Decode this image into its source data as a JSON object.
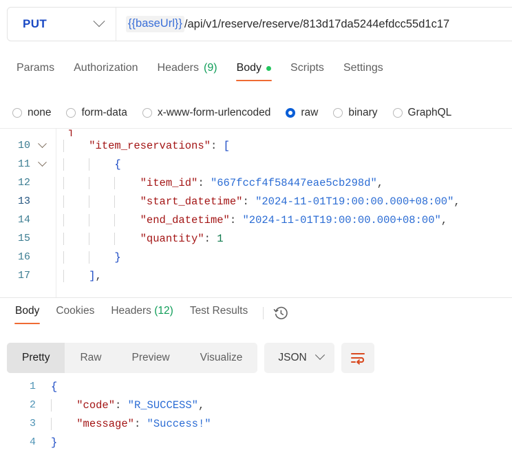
{
  "request": {
    "method": "PUT",
    "method_dropdown_icon": "chevron-down-icon",
    "url_variable": "{{baseUrl}}",
    "url_path": "/api/v1/reserve/reserve/813d17da5244efdcc55d1c17",
    "tabs": [
      {
        "label": "Params",
        "active": false,
        "count": "",
        "dot": false
      },
      {
        "label": "Authorization",
        "active": false,
        "count": "",
        "dot": false
      },
      {
        "label": "Headers",
        "active": false,
        "count": "(9)",
        "dot": false
      },
      {
        "label": "Body",
        "active": true,
        "count": "",
        "dot": true
      },
      {
        "label": "Scripts",
        "active": false,
        "count": "",
        "dot": false
      },
      {
        "label": "Settings",
        "active": false,
        "count": "",
        "dot": false
      }
    ],
    "body_types": [
      {
        "label": "none",
        "selected": false
      },
      {
        "label": "form-data",
        "selected": false
      },
      {
        "label": "x-www-form-urlencoded",
        "selected": false
      },
      {
        "label": "raw",
        "selected": true
      },
      {
        "label": "binary",
        "selected": false
      },
      {
        "label": "GraphQL",
        "selected": false
      }
    ],
    "clipped_line_above": "],",
    "code_lines": [
      {
        "number": "10",
        "foldable": true,
        "active": false,
        "indent_guides": 1,
        "tokens": [
          {
            "t": "    ",
            "c": "p"
          },
          {
            "t": "\"item_reservations\"",
            "c": "k"
          },
          {
            "t": ": ",
            "c": "p"
          },
          {
            "t": "[",
            "c": "b"
          }
        ]
      },
      {
        "number": "11",
        "foldable": true,
        "active": false,
        "indent_guides": 2,
        "tokens": [
          {
            "t": "        ",
            "c": "p"
          },
          {
            "t": "{",
            "c": "b"
          }
        ]
      },
      {
        "number": "12",
        "foldable": false,
        "active": false,
        "indent_guides": 3,
        "tokens": [
          {
            "t": "            ",
            "c": "p"
          },
          {
            "t": "\"item_id\"",
            "c": "k"
          },
          {
            "t": ": ",
            "c": "p"
          },
          {
            "t": "\"667fccf4f58447eae5cb298d\"",
            "c": "s"
          },
          {
            "t": ",",
            "c": "p"
          }
        ]
      },
      {
        "number": "13",
        "foldable": false,
        "active": true,
        "indent_guides": 3,
        "tokens": [
          {
            "t": "            ",
            "c": "p"
          },
          {
            "t": "\"start_datetime\"",
            "c": "k"
          },
          {
            "t": ": ",
            "c": "p"
          },
          {
            "t": "\"2024-11-01T19:00:00.000+08:00\"",
            "c": "s"
          },
          {
            "t": ",",
            "c": "p"
          }
        ]
      },
      {
        "number": "14",
        "foldable": false,
        "active": false,
        "indent_guides": 3,
        "tokens": [
          {
            "t": "            ",
            "c": "p"
          },
          {
            "t": "\"end_datetime\"",
            "c": "k"
          },
          {
            "t": ": ",
            "c": "p"
          },
          {
            "t": "\"2024-11-01T19:00:00.000+08:00\"",
            "c": "s"
          },
          {
            "t": ",",
            "c": "p"
          }
        ]
      },
      {
        "number": "15",
        "foldable": false,
        "active": false,
        "indent_guides": 3,
        "tokens": [
          {
            "t": "            ",
            "c": "p"
          },
          {
            "t": "\"quantity\"",
            "c": "k"
          },
          {
            "t": ": ",
            "c": "p"
          },
          {
            "t": "1",
            "c": "n"
          }
        ]
      },
      {
        "number": "16",
        "foldable": false,
        "active": false,
        "indent_guides": 2,
        "tokens": [
          {
            "t": "        ",
            "c": "p"
          },
          {
            "t": "}",
            "c": "b"
          }
        ]
      },
      {
        "number": "17",
        "foldable": false,
        "active": false,
        "indent_guides": 1,
        "tokens": [
          {
            "t": "    ",
            "c": "p"
          },
          {
            "t": "]",
            "c": "b"
          },
          {
            "t": ",",
            "c": "p"
          }
        ]
      }
    ]
  },
  "response": {
    "tabs": [
      {
        "label": "Body",
        "active": true,
        "count": ""
      },
      {
        "label": "Cookies",
        "active": false,
        "count": ""
      },
      {
        "label": "Headers",
        "active": false,
        "count": "(12)"
      },
      {
        "label": "Test Results",
        "active": false,
        "count": ""
      }
    ],
    "history_icon": "history-clock-icon",
    "format_tabs": [
      {
        "label": "Pretty",
        "active": true
      },
      {
        "label": "Raw",
        "active": false
      },
      {
        "label": "Preview",
        "active": false
      },
      {
        "label": "Visualize",
        "active": false
      }
    ],
    "language_select": {
      "value": "JSON",
      "icon": "chevron-down-icon"
    },
    "wrap_button_icon": "wrap-text-icon",
    "body_lines": [
      {
        "number": "1",
        "indent_guides": 0,
        "tokens": [
          {
            "t": "{",
            "c": "b"
          }
        ]
      },
      {
        "number": "2",
        "indent_guides": 1,
        "tokens": [
          {
            "t": "    ",
            "c": "p"
          },
          {
            "t": "\"code\"",
            "c": "k"
          },
          {
            "t": ": ",
            "c": "p"
          },
          {
            "t": "\"R_SUCCESS\"",
            "c": "s"
          },
          {
            "t": ",",
            "c": "p"
          }
        ]
      },
      {
        "number": "3",
        "indent_guides": 1,
        "tokens": [
          {
            "t": "    ",
            "c": "p"
          },
          {
            "t": "\"message\"",
            "c": "k"
          },
          {
            "t": ": ",
            "c": "p"
          },
          {
            "t": "\"Success!\"",
            "c": "s"
          }
        ]
      },
      {
        "number": "4",
        "indent_guides": 0,
        "tokens": [
          {
            "t": "}",
            "c": "b"
          }
        ]
      }
    ]
  },
  "colors": {
    "accent_orange": "#ef6b33",
    "method_blue": "#1a49c4",
    "radio_blue": "#0a5ed7",
    "dot_green": "#22c55e",
    "count_green": "#0f9d58",
    "json_key": "#a31515",
    "json_string": "#2b6cd4",
    "json_number": "#0f7a4d",
    "gutter_number": "#3b7c91"
  }
}
